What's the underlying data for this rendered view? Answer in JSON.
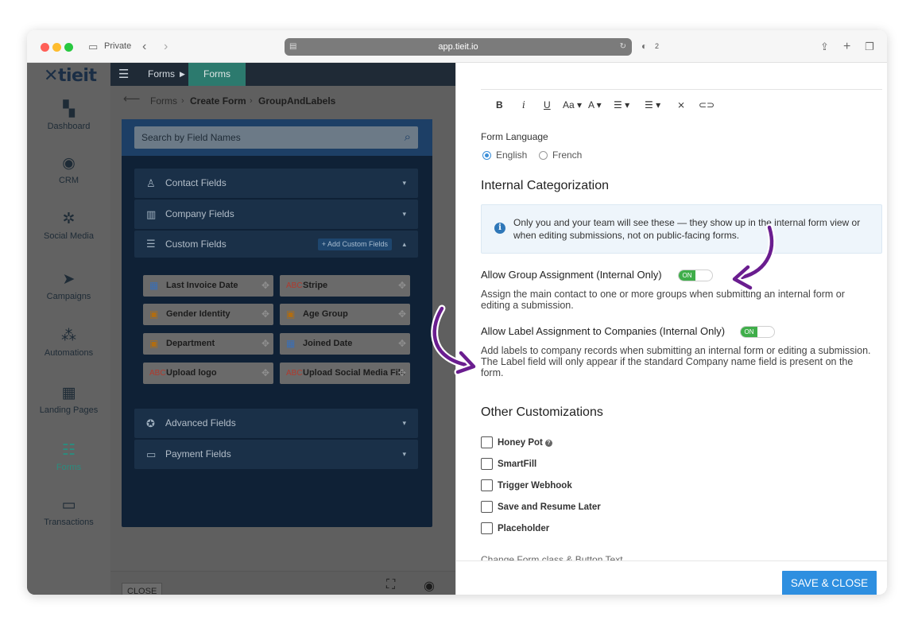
{
  "browser": {
    "mode_label": "Private",
    "url": "app.tieit.io",
    "shield_count": "2"
  },
  "app": {
    "logo": "tieit",
    "sidebar": {
      "items": [
        {
          "label": "Dashboard",
          "icon": "dashboard-icon"
        },
        {
          "label": "CRM",
          "icon": "crm-icon"
        },
        {
          "label": "Social Media",
          "icon": "social-network-icon"
        },
        {
          "label": "Campaigns",
          "icon": "send-icon"
        },
        {
          "label": "Automations",
          "icon": "automation-icon"
        },
        {
          "label": "Landing Pages",
          "icon": "landing-page-icon"
        },
        {
          "label": "Forms",
          "icon": "forms-icon",
          "active": true
        },
        {
          "label": "Transactions",
          "icon": "card-icon"
        }
      ]
    },
    "topbar": {
      "crumb1": "Forms",
      "crumb2": "Forms"
    },
    "breadcrumb": {
      "items": [
        "Forms",
        "Create Form",
        "GroupAndLabels"
      ]
    },
    "search": {
      "placeholder": "Search by Field Names"
    },
    "accordions": {
      "contact": "Contact Fields",
      "company": "Company Fields",
      "custom": "Custom Fields",
      "add_custom": "+ Add Custom Fields",
      "advanced": "Advanced Fields",
      "payment": "Payment Fields"
    },
    "custom_fields": [
      {
        "label": "Last Invoice Date",
        "icon": "calendar-icon"
      },
      {
        "label": "Stripe",
        "icon": "text-field-icon"
      },
      {
        "label": "Gender Identity",
        "icon": "dropdown-icon"
      },
      {
        "label": "Age Group",
        "icon": "dropdown-icon"
      },
      {
        "label": "Department",
        "icon": "dropdown-icon"
      },
      {
        "label": "Joined Date",
        "icon": "calendar-icon"
      },
      {
        "label": "Upload logo",
        "icon": "text-field-icon"
      },
      {
        "label": "Upload Social Media File",
        "icon": "text-field-icon"
      }
    ],
    "footer": {
      "close_label": "CLOSE"
    }
  },
  "settings": {
    "toolbar": [
      "B",
      "i",
      "U",
      "Aa",
      "A"
    ],
    "form_language": {
      "title": "Form Language",
      "options": [
        "English",
        "French"
      ],
      "selected": "English"
    },
    "internal": {
      "title": "Internal Categorization",
      "info": "Only you and your team will see these — they show up in the internal form view or when editing submissions, not on public-facing forms.",
      "group": {
        "title": "Allow Group Assignment (Internal Only)",
        "toggle": "ON",
        "desc": "Assign the main contact to one or more groups when submitting an internal form or editing a submission."
      },
      "label": {
        "title": "Allow Label Assignment to Companies (Internal Only)",
        "toggle": "ON",
        "desc": "Add labels to company records when submitting an internal form or editing a submission. The Label field will only appear if the standard Company name field is present on the form."
      }
    },
    "other": {
      "title": "Other Customizations",
      "options": [
        "Honey Pot",
        "SmartFill",
        "Trigger Webhook",
        "Save and Resume Later",
        "Placeholder"
      ]
    },
    "cutoff_text": "Change Form class & Button Text",
    "save_label": "SAVE & CLOSE"
  },
  "colors": {
    "accent": "#2e8fe0",
    "toggle_on": "#3fae4a",
    "annotation": "#6a1d8f",
    "nav_active": "#2a8d7f"
  }
}
